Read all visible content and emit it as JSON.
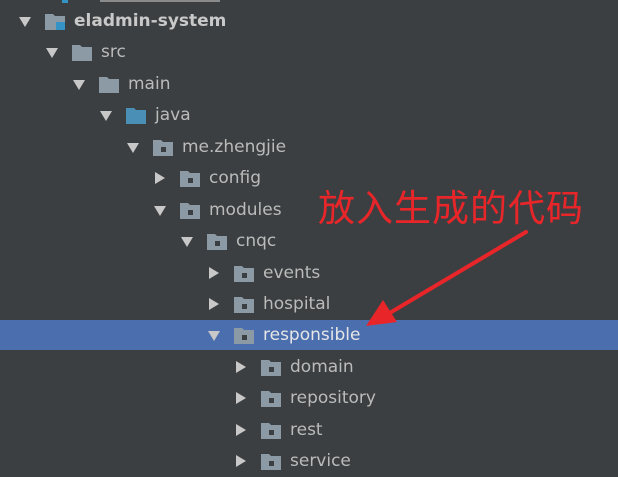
{
  "tree": {
    "items": [
      {
        "label": "eladmin-system",
        "expanded": true,
        "kind": "module",
        "bold": true
      },
      {
        "label": "src",
        "expanded": true,
        "kind": "folder"
      },
      {
        "label": "main",
        "expanded": true,
        "kind": "folder"
      },
      {
        "label": "java",
        "expanded": true,
        "kind": "source-root"
      },
      {
        "label": "me.zhengjie",
        "expanded": true,
        "kind": "package"
      },
      {
        "label": "config",
        "expanded": false,
        "kind": "package"
      },
      {
        "label": "modules",
        "expanded": true,
        "kind": "package"
      },
      {
        "label": "cnqc",
        "expanded": true,
        "kind": "package"
      },
      {
        "label": "events",
        "expanded": false,
        "kind": "package"
      },
      {
        "label": "hospital",
        "expanded": false,
        "kind": "package"
      },
      {
        "label": "responsible",
        "expanded": true,
        "kind": "package",
        "selected": true
      },
      {
        "label": "domain",
        "expanded": false,
        "kind": "package"
      },
      {
        "label": "repository",
        "expanded": false,
        "kind": "package"
      },
      {
        "label": "rest",
        "expanded": false,
        "kind": "package"
      },
      {
        "label": "service",
        "expanded": false,
        "kind": "package"
      }
    ]
  },
  "annotation": {
    "text": "放入生成的代码",
    "color": "#e8262a"
  },
  "colors": {
    "background": "#3c3f41",
    "selection": "#4b6eaf",
    "text": "#bbbbbb",
    "folder": "#8c9aa6",
    "source_root": "#4a8fb5",
    "module_badge": "#3592c4"
  },
  "icons": {
    "expanded": "chevron-down-icon",
    "collapsed": "chevron-right-icon",
    "folder": "folder-icon",
    "package": "package-icon",
    "source_root": "source-folder-icon",
    "module": "module-folder-icon"
  }
}
